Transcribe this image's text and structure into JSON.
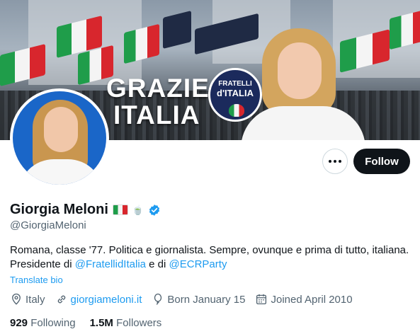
{
  "banner": {
    "headline_line1": "GRAZIE",
    "headline_line2": "ITALIA",
    "logo_line1": "FRATELLI",
    "logo_line2": "d'ITALIA"
  },
  "actions": {
    "more_icon": "more-horizontal-icon",
    "follow_label": "Follow"
  },
  "profile": {
    "name": "Giorgia Meloni",
    "name_emoji": "🍵",
    "handle": "@GiorgiaMeloni",
    "bio_line1": "Romana, classe '77. Politica e giornalista. Sempre, ovunque e prima di tutto, italiana.",
    "bio_line2_prefix": "Presidente di ",
    "bio_mention1": "@FratellidItalia",
    "bio_line2_mid": " e di ",
    "bio_mention2": "@ECRParty",
    "translate_label": "Translate bio"
  },
  "meta": {
    "location": "Italy",
    "website": "giorgiameloni.it",
    "born": "Born January 15",
    "joined": "Joined April 2010"
  },
  "stats": {
    "following_count": "929",
    "following_label": "Following",
    "followers_count": "1.5M",
    "followers_label": "Followers"
  },
  "colors": {
    "accent": "#1d9bf0",
    "text": "#0f1419",
    "secondary": "#536471",
    "follow_bg": "#0f1419"
  }
}
